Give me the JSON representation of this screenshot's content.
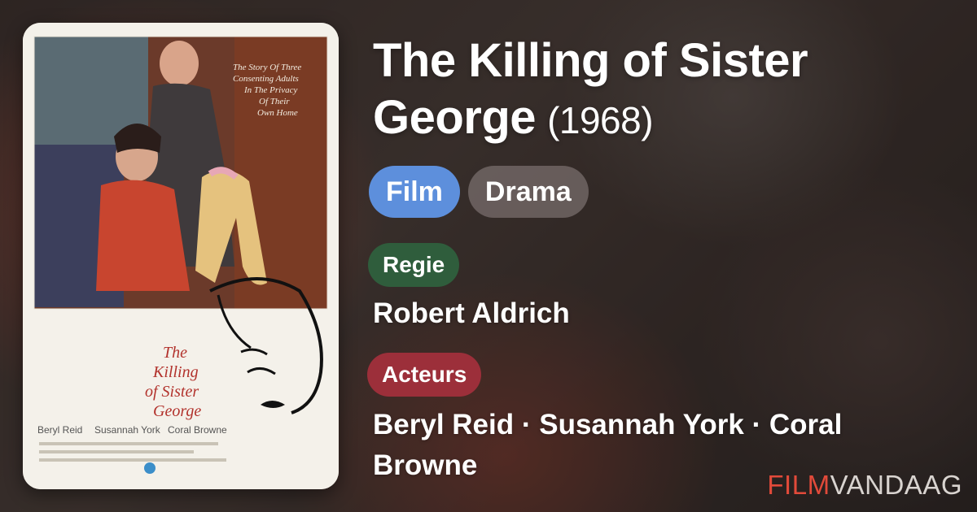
{
  "movie": {
    "title_line1": "The Killing of Sister",
    "title_line2": "George",
    "year": "(1968)"
  },
  "chips": {
    "type": "Film",
    "genre": "Drama"
  },
  "director": {
    "label": "Regie",
    "name": "Robert Aldrich"
  },
  "cast": {
    "label": "Acteurs",
    "line1": "Beryl Reid · Susannah York · Coral",
    "line2": "Browne"
  },
  "brand": {
    "part1": "FILM",
    "part2": "VANDAAG"
  },
  "poster": {
    "tagline": [
      "The Story Of Three",
      "Consenting Adults",
      "In The Privacy",
      "Of Their",
      "Own Home"
    ],
    "title": [
      "The",
      "Killing",
      "of Sister",
      "George"
    ],
    "credits": [
      "Beryl Reid",
      "Susannah York",
      "Coral Browne"
    ]
  },
  "colors": {
    "film_chip": "#5d8fdc",
    "regie_label": "#2f5d3c",
    "acteurs_label": "#9c2f3a",
    "brand_accent": "#e24a3a"
  }
}
